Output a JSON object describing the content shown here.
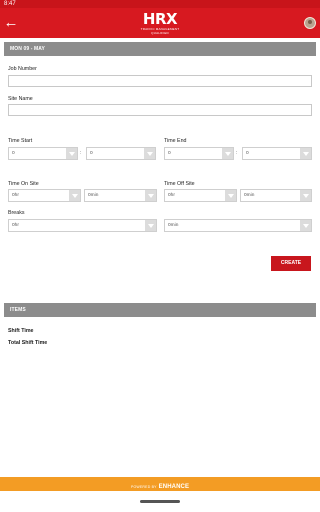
{
  "status_bar": {
    "time": "8:47"
  },
  "header": {
    "back_icon": "arrow-left-icon",
    "logo_text": "HRX",
    "logo_tagline": "TRAFFIC MANAGEMENT QUALIFIED",
    "avatar_icon": "user-avatar"
  },
  "date_header": {
    "label": "MON 09 - MAY"
  },
  "form": {
    "job_number": {
      "label": "Job Number",
      "value": ""
    },
    "site_name": {
      "label": "Site Name",
      "value": ""
    },
    "time_start": {
      "label": "Time Start",
      "hour": "0",
      "minute": "0",
      "separator": ":"
    },
    "time_end": {
      "label": "Time End",
      "hour": "0",
      "minute": "0",
      "separator": ":"
    },
    "time_on_site": {
      "label": "Time On Site",
      "hours": "0hr",
      "minutes": "0min"
    },
    "time_off_site": {
      "label": "Time Off Site",
      "hours": "0hr",
      "minutes": "0min"
    },
    "breaks": {
      "label": "Breaks",
      "hours": "0hr",
      "minutes": "0min"
    },
    "create_label": "CREATE"
  },
  "items_header": {
    "label": "ITEMS"
  },
  "summary": {
    "shift_time_label": "Shift Time",
    "total_shift_time_label": "Total Shift Time"
  },
  "footer": {
    "powered_by": "POWERED BY",
    "brand": "ENHANCE"
  },
  "colors": {
    "primary": "#d71920",
    "section": "#8c8c8c",
    "footer": "#f39c24"
  }
}
